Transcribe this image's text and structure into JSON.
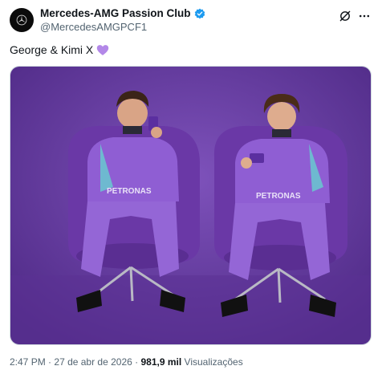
{
  "account": {
    "display_name": "Mercedes-AMG Passion Club",
    "handle": "@MercedesAMGPCF1",
    "avatar_icon": "mercedes-star-logo",
    "verified_color": "#1d9bf0"
  },
  "tweet": {
    "text": "George & Kimi X",
    "emoji_icon": "purple-heart",
    "emoji_color": "#b388e8"
  },
  "media": {
    "subject": "two drivers in purple racing suits seated on purple egg chairs against a purple backdrop",
    "suit_logo": "PETRONAS",
    "background_color": "#6b3fa8",
    "suit_color": "#8e5cd0"
  },
  "meta": {
    "time": "2:47 PM",
    "separator": "·",
    "date": "27 de abr de 2026",
    "views_count": "981,9 mil",
    "views_label": "Visualizações"
  }
}
